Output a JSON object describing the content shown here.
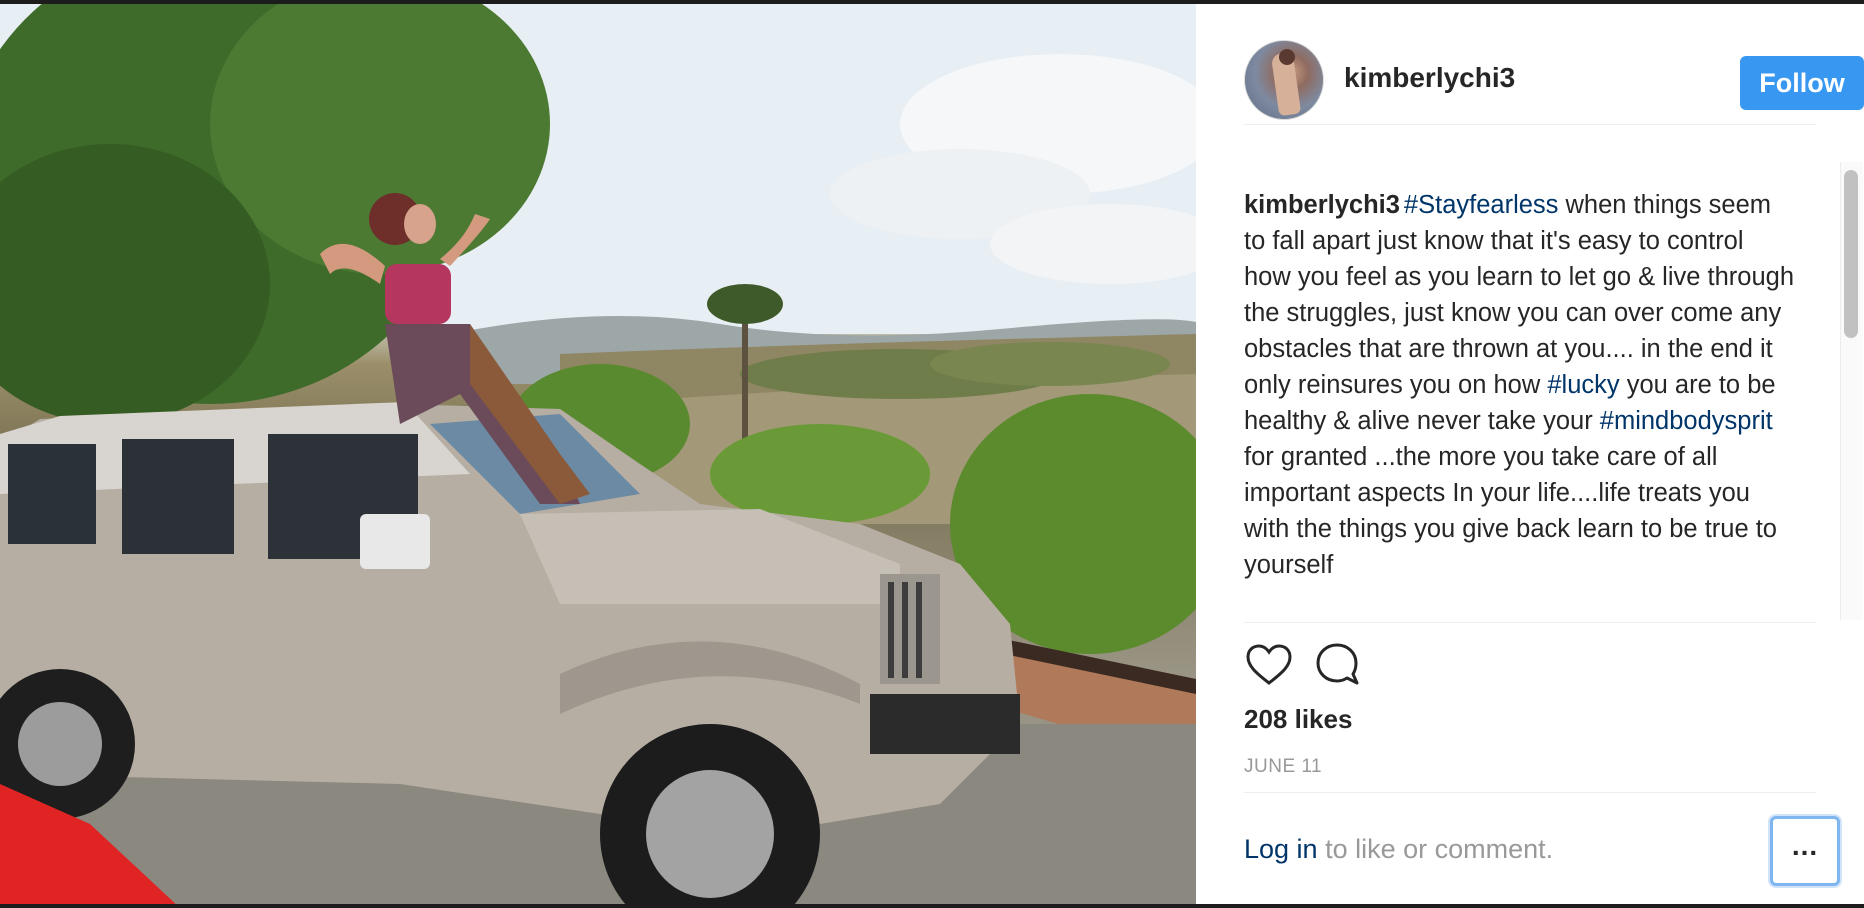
{
  "photo": {
    "alt_icon": "photo-image"
  },
  "post": {
    "username": "kimberlychi3",
    "follow_label": "Follow",
    "caption": {
      "user": "kimberlychi3",
      "segments": [
        {
          "type": "tag",
          "text": "#Stayfearless"
        },
        {
          "type": "text",
          "text": " when things seem to fall apart just know that it's easy to control how you feel as you learn to let go & live through the struggles, just know you can over come any obstacles that are thrown at you.... in the end it only reinsures you on how "
        },
        {
          "type": "tag",
          "text": "#lucky"
        },
        {
          "type": "text",
          "text": " you are to be healthy & alive never take your "
        },
        {
          "type": "tag",
          "text": "#mindbodysprit"
        },
        {
          "type": "text",
          "text": " for granted ...the more you take care of all important aspects In your life....life treats you with the things you give back learn to be true to yourself"
        }
      ]
    },
    "likes": "208 likes",
    "date": "JUNE 11",
    "login_link": "Log in",
    "login_rest": " to like or comment.",
    "more_label": "..."
  },
  "icons": {
    "like": "heart-icon",
    "comment": "comment-icon",
    "more": "ellipsis-icon"
  },
  "colors": {
    "follow_bg": "#3897f0",
    "hashtag": "#003569",
    "muted": "#999999",
    "text": "#262626"
  }
}
